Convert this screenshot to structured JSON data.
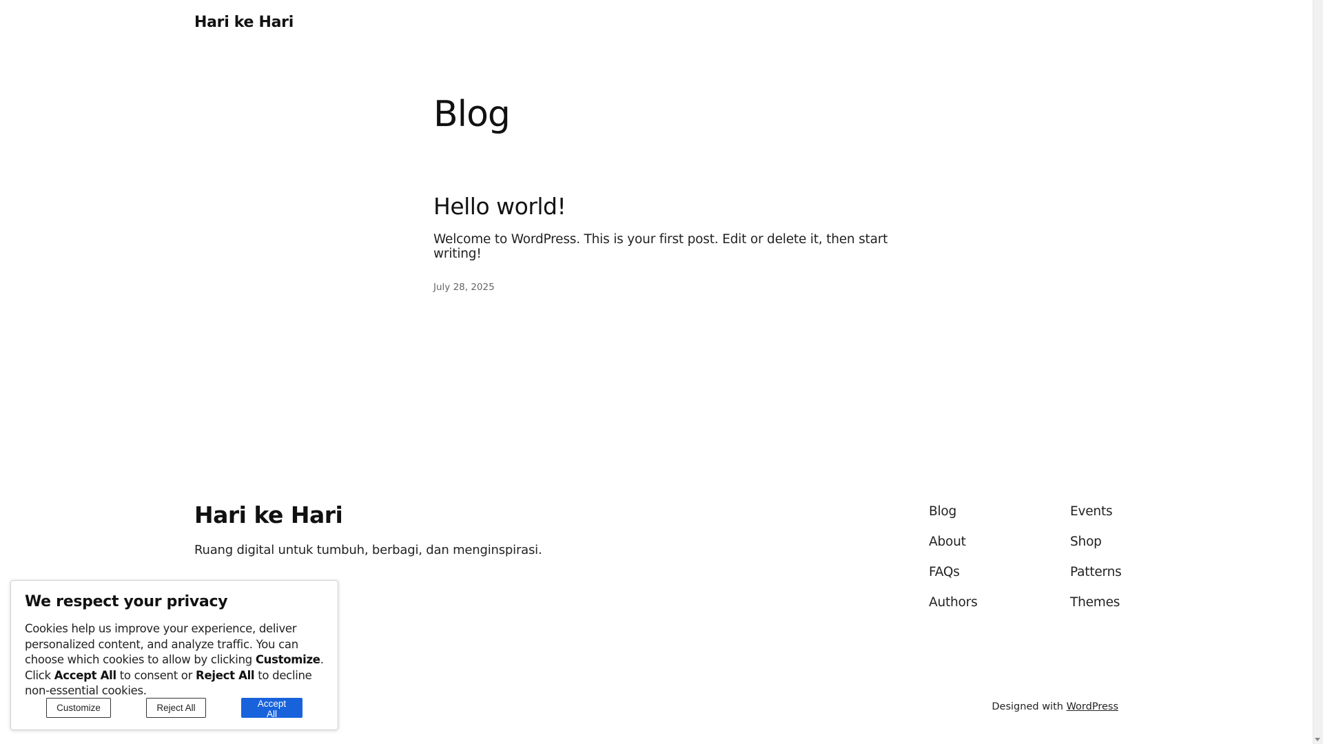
{
  "header": {
    "site_title": "Hari ke Hari"
  },
  "main": {
    "page_title": "Blog",
    "post": {
      "title": "Hello world!",
      "excerpt": "Welcome to WordPress. This is your first post. Edit or delete it, then start writing!",
      "date": "July 28, 2025"
    }
  },
  "footer": {
    "site_title": "Hari ke Hari",
    "tagline": "Ruang digital untuk tumbuh, berbagi, dan menginspirasi.",
    "nav_col1": [
      "Blog",
      "About",
      "FAQs",
      "Authors"
    ],
    "nav_col2": [
      "Events",
      "Shop",
      "Patterns",
      "Themes"
    ],
    "credits_prefix": "Designed with",
    "credits_link": "WordPress"
  },
  "cookie_banner": {
    "title": "We respect your privacy",
    "text_1": "Cookies help us improve your experience, deliver personalized content, and analyze traffic. You can choose which cookies to allow by clicking ",
    "bold_customize": "Customize",
    "text_2": ". Click ",
    "bold_accept": "Accept All",
    "text_3": " to consent or ",
    "bold_reject": "Reject All",
    "text_4": " to decline non-essential cookies.",
    "customize_label": "Customize",
    "reject_label": "Reject All",
    "accept_label": "Accept All",
    "accept_color": "#1863dc"
  }
}
